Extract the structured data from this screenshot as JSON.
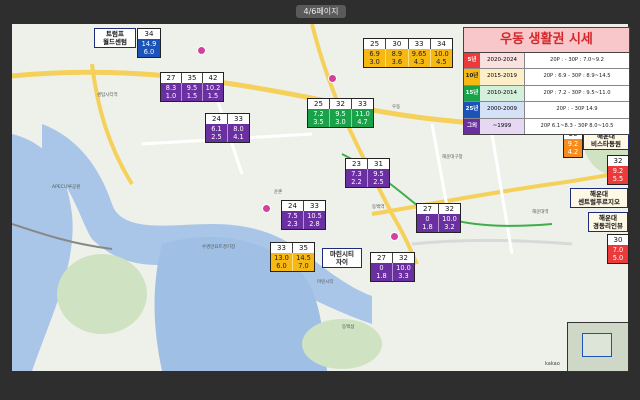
{
  "page": {
    "indicator": "4/6페이지"
  },
  "legend": {
    "title": "우동 생활권 시세",
    "rows": [
      {
        "tag": "5년",
        "range": "2020-2024",
        "price": "20P : - 30P : 7.0~9.2",
        "color": "#ec3a3a"
      },
      {
        "tag": "10년",
        "range": "2015-2019",
        "price": "20P : 6.9 - 30P : 8.9~14.5",
        "color": "#f6b812"
      },
      {
        "tag": "15년",
        "range": "2010-2014",
        "price": "20P : 7.2 - 30P : 9.5~11.0",
        "color": "#1aa14a"
      },
      {
        "tag": "25년",
        "range": "2000-2009",
        "price": "20P : - 30P 14.9",
        "color": "#1b53b8"
      },
      {
        "tag": "그외",
        "range": "~1999",
        "price": "20P 6.1~8.3 - 30P 8.0~10.5",
        "color": "#6a2fa0"
      }
    ]
  },
  "tables": [
    {
      "id": "trump",
      "sizes": [
        "34"
      ],
      "cells": [
        [
          "14.9",
          "6.0"
        ]
      ],
      "colors": [
        "blue"
      ]
    },
    {
      "id": "t1",
      "sizes": [
        "27",
        "35",
        "42"
      ],
      "cells": [
        [
          "8.3",
          "1.0"
        ],
        [
          "9.5",
          "1.5"
        ],
        [
          "10.2",
          "1.5"
        ]
      ],
      "colors": [
        "purple",
        "purple",
        "purple"
      ]
    },
    {
      "id": "t2",
      "sizes": [
        "25",
        "30",
        "33",
        "34"
      ],
      "cells": [
        [
          "6.9",
          "3.0"
        ],
        [
          "8.9",
          "3.6"
        ],
        [
          "9.65",
          "4.3"
        ],
        [
          "10.0",
          "4.5"
        ]
      ],
      "colors": [
        "yellow",
        "yellow",
        "yellow",
        "yellow"
      ]
    },
    {
      "id": "t3",
      "sizes": [
        "24",
        "33"
      ],
      "cells": [
        [
          "6.1",
          "2.5"
        ],
        [
          "8.0",
          "4.1"
        ]
      ],
      "colors": [
        "purple",
        "purple"
      ]
    },
    {
      "id": "t4",
      "sizes": [
        "25",
        "32",
        "33"
      ],
      "cells": [
        [
          "7.2",
          "3.5"
        ],
        [
          "9.5",
          "3.0"
        ],
        [
          "11.0",
          "4.7"
        ]
      ],
      "colors": [
        "green",
        "green",
        "green"
      ]
    },
    {
      "id": "t5",
      "sizes": [
        "23",
        "31"
      ],
      "cells": [
        [
          "7.3",
          "2.2"
        ],
        [
          "9.5",
          "2.5"
        ]
      ],
      "colors": [
        "purple",
        "purple"
      ]
    },
    {
      "id": "t6",
      "sizes": [
        "24",
        "33"
      ],
      "cells": [
        [
          "7.5",
          "2.3"
        ],
        [
          "10.5",
          "2.8"
        ]
      ],
      "colors": [
        "purple",
        "purple"
      ]
    },
    {
      "id": "t7",
      "sizes": [
        "33",
        "35"
      ],
      "cells": [
        [
          "13.0",
          "6.0"
        ],
        [
          "14.5",
          "7.0"
        ]
      ],
      "colors": [
        "yellow",
        "yellow"
      ]
    },
    {
      "id": "t8",
      "sizes": [
        "27",
        "32"
      ],
      "cells": [
        [
          "0",
          "1.8"
        ],
        [
          "10.0",
          "3.2"
        ]
      ],
      "colors": [
        "purple",
        "purple"
      ]
    },
    {
      "id": "t9",
      "sizes": [
        "27",
        "32"
      ],
      "cells": [
        [
          "0",
          "1.8"
        ],
        [
          "10.0",
          "3.3"
        ]
      ],
      "colors": [
        "purple",
        "purple"
      ]
    },
    {
      "id": "t10",
      "sizes": [
        "36"
      ],
      "cells": [
        [
          "9.2",
          "4.2"
        ]
      ],
      "colors": [
        "orange"
      ]
    },
    {
      "id": "t11",
      "sizes": [
        "32"
      ],
      "cells": [
        [
          "9.2",
          "5.5"
        ]
      ],
      "colors": [
        "red"
      ]
    },
    {
      "id": "t12",
      "sizes": [
        "30"
      ],
      "cells": [
        [
          "7.0",
          "5.0"
        ]
      ],
      "colors": [
        "red"
      ]
    }
  ],
  "labels": {
    "trump": "트럼프\n월드센텀",
    "marina": "마린시티\n자이",
    "haeundae_bistro": "해운대\n비스타동원",
    "haeundae_central": "해운대\n센트럴푸르지오",
    "haeundae_gyeongdong": "해운대\n경동리인뷰"
  },
  "map": {
    "attribution": "kakao"
  },
  "poi": [
    "센텀시티역",
    "해운대구청",
    "동백역",
    "운촌",
    "마린시티",
    "우동",
    "해운대역",
    "수영만요트경기장",
    "APEC나루공원",
    "동백섬"
  ]
}
